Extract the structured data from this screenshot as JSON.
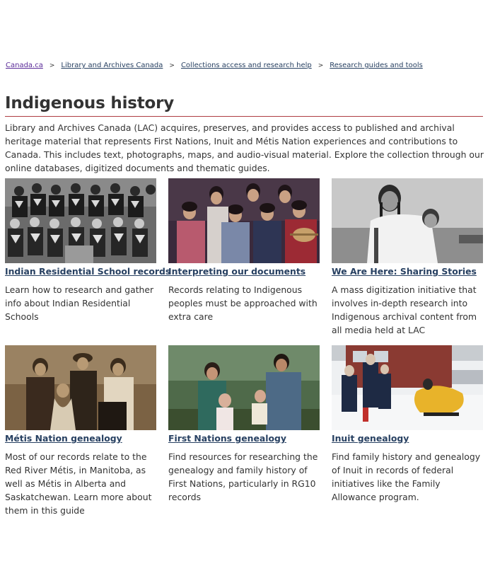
{
  "breadcrumb": [
    {
      "label": "Canada.ca"
    },
    {
      "label": "Library and Archives Canada"
    },
    {
      "label": "Collections access and research help"
    },
    {
      "label": "Research guides and tools"
    }
  ],
  "page": {
    "title": "Indigenous history",
    "intro": "Library and Archives Canada (LAC) acquires, preserves, and provides access to published and archival heritage material that represents First Nations, Inuit and Métis Nation experiences and contributions to Canada. This includes text, photographs, maps, and audio-visual material. Explore the collection through our online databases, digitized documents and thematic guides."
  },
  "colors": {
    "link": "#284162",
    "visited_link": "#5b2c99",
    "title_rule": "#af3c43"
  },
  "cards": [
    {
      "title": "Indian Residential School records",
      "description": "Learn how to research and gather info about Indian Residential Schools"
    },
    {
      "title": "Interpreting our documents",
      "description": "Records relating to Indigenous peoples must be approached with extra care"
    },
    {
      "title": "We Are Here: Sharing Stories",
      "description": "A mass digitization initiative that involves in-depth research into Indigenous archival content from all media held at LAC"
    },
    {
      "title": "Métis Nation genealogy",
      "description": "Most of our records relate to the Red River Métis, in Manitoba, as well as Métis in Alberta and Saskatchewan. Learn more about them in this guide"
    },
    {
      "title": "First Nations genealogy",
      "description": "Find resources for researching the genealogy and family history of First Nations, particularly in RG10 records"
    },
    {
      "title": "Inuit genealogy",
      "description": "Find family history and genealogy of Inuit in records of federal initiatives like the Family Allowance program."
    }
  ]
}
